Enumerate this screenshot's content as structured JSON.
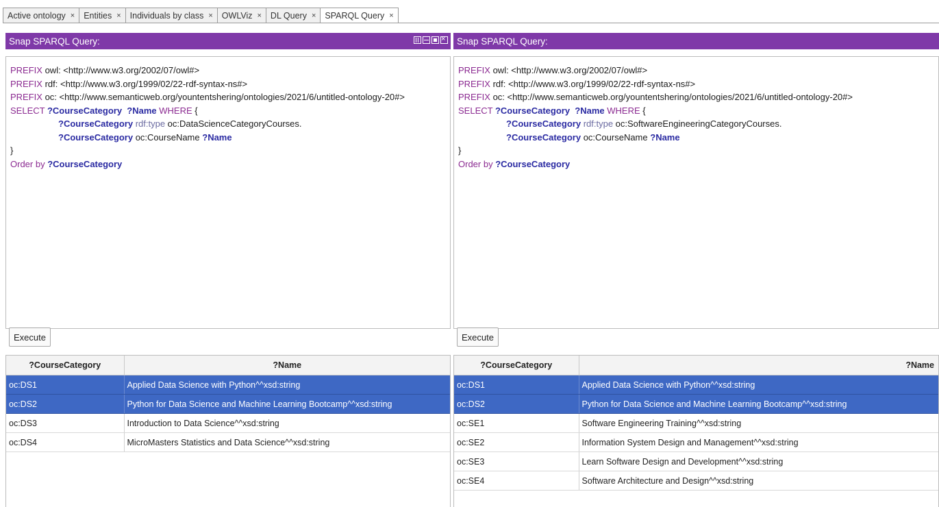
{
  "tabs": [
    {
      "label": "Active ontology",
      "close": "×"
    },
    {
      "label": "Entities",
      "close": "×"
    },
    {
      "label": "Individuals by class",
      "close": "×"
    },
    {
      "label": "OWLViz",
      "close": "×"
    },
    {
      "label": "DL Query",
      "close": "×"
    },
    {
      "label": "SPARQL Query",
      "close": "×"
    }
  ],
  "left": {
    "title": "Snap SPARQL Query:",
    "query": {
      "l1_kw": "PREFIX",
      "l1_rest": " owl: <http://www.w3.org/2002/07/owl#>",
      "l2_kw": "PREFIX",
      "l2_rest": " rdf: <http://www.w3.org/1999/02/22-rdf-syntax-ns#>",
      "l3_kw": "PREFIX",
      "l3_rest": " oc: <http://www.semanticweb.org/yountentshering/ontologies/2021/6/untitled-ontology-20#>",
      "l4_kw": "SELECT",
      "l4_v1": "?CourseCategory",
      "l4_v2": "?Name",
      "l4_kw2": "WHERE",
      "l4_brace": " {",
      "l5_v": "?CourseCategory",
      "l5_pred": "rdf:type",
      "l5_obj": " oc:DataScienceCategoryCourses.",
      "l6_v": "?CourseCategory",
      "l6_pred": " oc:CourseName",
      "l6_v2": "?Name",
      "l7": "}",
      "l8_kw": "Order by",
      "l8_v": "?CourseCategory"
    },
    "execute_label": "Execute",
    "columns": [
      "?CourseCategory",
      "?Name"
    ],
    "rows": [
      {
        "cat": "oc:DS1",
        "name": "Applied Data Science with Python^^xsd:string",
        "selected": true
      },
      {
        "cat": "oc:DS2",
        "name": "Python for Data Science and Machine Learning Bootcamp^^xsd:string",
        "selected": true
      },
      {
        "cat": "oc:DS3",
        "name": "Introduction to Data Science^^xsd:string",
        "selected": false
      },
      {
        "cat": "oc:DS4",
        "name": "MicroMasters Statistics and Data Science^^xsd:string",
        "selected": false
      }
    ]
  },
  "right": {
    "title": "Snap SPARQL Query:",
    "query": {
      "l1_kw": "PREFIX",
      "l1_rest": " owl: <http://www.w3.org/2002/07/owl#>",
      "l2_kw": "PREFIX",
      "l2_rest": " rdf: <http://www.w3.org/1999/02/22-rdf-syntax-ns#>",
      "l3_kw": "PREFIX",
      "l3_rest": " oc: <http://www.semanticweb.org/yountentshering/ontologies/2021/6/untitled-ontology-20#>",
      "l4_kw": "SELECT",
      "l4_v1": "?CourseCategory",
      "l4_v2": "?Name",
      "l4_kw2": "WHERE",
      "l4_brace": " {",
      "l5_v": "?CourseCategory",
      "l5_pred": "rdf:type",
      "l5_obj": " oc:SoftwareEngineeringCategoryCourses.",
      "l6_v": "?CourseCategory",
      "l6_pred": " oc:CourseName",
      "l6_v2": "?Name",
      "l7": "}",
      "l8_kw": "Order by",
      "l8_v": "?CourseCategory"
    },
    "execute_label": "Execute",
    "columns": [
      "?CourseCategory",
      "?Name"
    ],
    "rows": [
      {
        "cat": "oc:DS1",
        "name": "Applied Data Science with Python^^xsd:string",
        "selected": true
      },
      {
        "cat": "oc:DS2",
        "name": "Python for Data Science and Machine Learning Bootcamp^^xsd:string",
        "selected": true
      },
      {
        "cat": "oc:SE1",
        "name": "Software Engineering Training^^xsd:string",
        "selected": false
      },
      {
        "cat": "oc:SE2",
        "name": "Information System Design and Management^^xsd:string",
        "selected": false
      },
      {
        "cat": "oc:SE3",
        "name": "Learn Software Design and Development^^xsd:string",
        "selected": false
      },
      {
        "cat": "oc:SE4",
        "name": "Software Architecture and Design^^xsd:string",
        "selected": false
      }
    ]
  },
  "colors": {
    "title_bar": "#7f39a8",
    "selection": "#3e68c4",
    "keyword": "#8b2a91",
    "variable": "#2a2aa2"
  }
}
